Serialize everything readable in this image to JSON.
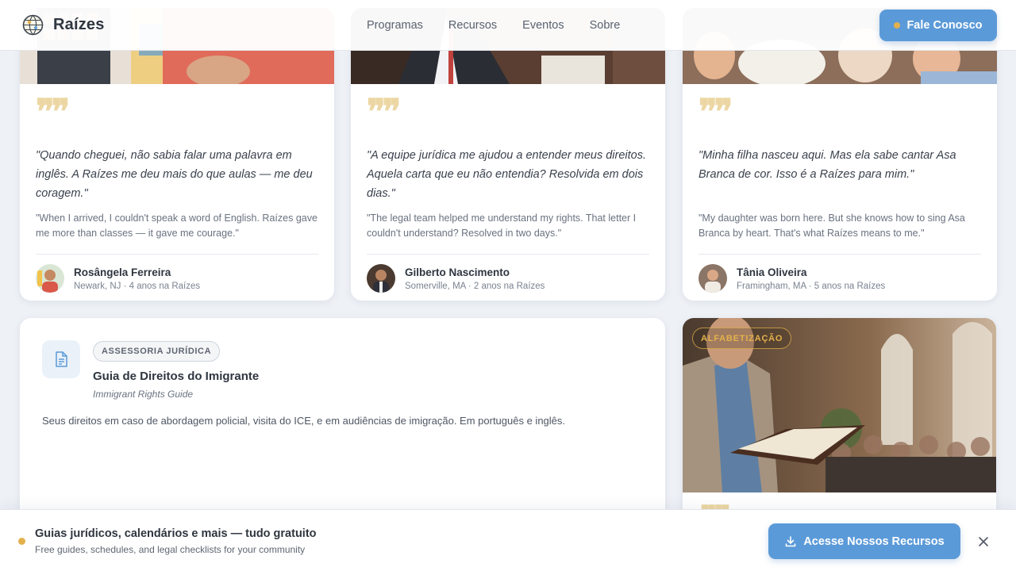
{
  "header": {
    "brand": "Raízes",
    "nav": [
      "Programas",
      "Recursos",
      "Eventos",
      "Sobre"
    ],
    "cta": "Fale Conosco"
  },
  "testimonials": [
    {
      "quote_pt": "\"Quando cheguei, não sabia falar uma palavra em inglês. A Raízes me deu mais do que aulas — me deu coragem.\"",
      "quote_en": "\"When I arrived, I couldn't speak a word of English. Raízes gave me more than classes — it gave me courage.\"",
      "name": "Rosângela Ferreira",
      "meta": "Newark, NJ · 4 anos na Raízes"
    },
    {
      "quote_pt": "\"A equipe jurídica me ajudou a entender meus direitos. Aquela carta que eu não entendia? Resolvida em dois dias.\"",
      "quote_en": "\"The legal team helped me understand my rights. That letter I couldn't understand? Resolved in two days.\"",
      "name": "Gilberto Nascimento",
      "meta": "Somerville, MA · 2 anos na Raízes"
    },
    {
      "quote_pt": "\"Minha filha nasceu aqui. Mas ela sabe cantar Asa Branca de cor. Isso é a Raízes para mim.\"",
      "quote_en": "\"My daughter was born here. But she knows how to sing Asa Branca by heart. That's what Raízes means to me.\"",
      "name": "Tânia Oliveira",
      "meta": "Framingham, MA · 5 anos na Raízes"
    }
  ],
  "resource": {
    "tag": "ASSESSORIA JURÍDICA",
    "title": "Guia de Direitos do Imigrante",
    "subtitle": "Immigrant Rights Guide",
    "description": "Seus direitos em caso de abordagem policial, visita do ICE, e em audiências de imigração. Em português e inglês."
  },
  "photo_card": {
    "tag": "ALFABETIZAÇÃO"
  },
  "banner": {
    "title": "Guias jurídicos, calendários e mais — tudo gratuito",
    "subtitle": "Free guides, schedules, and legal checklists for your community",
    "cta": "Acesse Nossos Recursos"
  },
  "colors": {
    "accent": "#5b9ad8",
    "gold": "#e3b04b",
    "quote_mark": "#ecd7a4"
  }
}
